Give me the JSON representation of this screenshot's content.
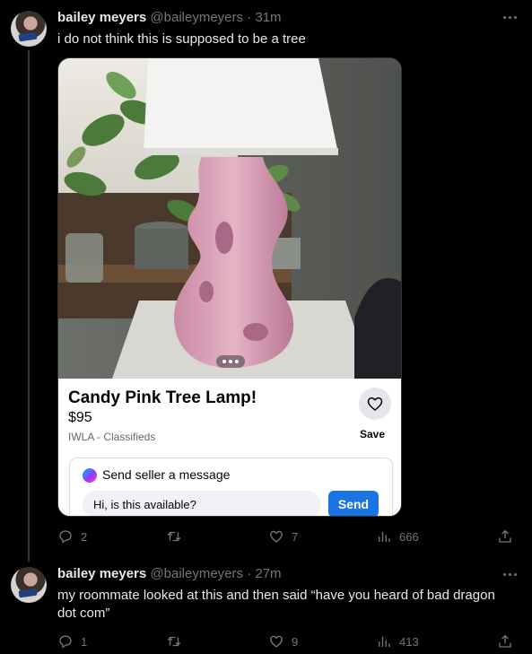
{
  "tweets": [
    {
      "name": "bailey meyers",
      "handle": "@baileymeyers",
      "separator": "·",
      "time": "31m",
      "text": "i do not think this is supposed to be a tree",
      "listing": {
        "title": "Candy Pink Tree Lamp!",
        "price": "$95",
        "location": "IWLA - Classifieds",
        "save_label": "Save",
        "message_title": "Send seller a message",
        "message_input": "Hi, is this available?",
        "send_label": "Send"
      },
      "replies": "2",
      "retweets": "",
      "likes": "7",
      "views": "666"
    },
    {
      "name": "bailey meyers",
      "handle": "@baileymeyers",
      "separator": "·",
      "time": "27m",
      "text": "my roommate looked at this and then said “have you heard of bad dragon dot com”",
      "replies": "1",
      "retweets": "",
      "likes": "9",
      "views": "413"
    }
  ],
  "icons": {
    "reply": "reply-icon",
    "retweet": "retweet-icon",
    "like": "heart-icon",
    "views": "views-icon",
    "share": "share-icon",
    "more": "more-icon"
  },
  "colors": {
    "background": "#000000",
    "secondary_text": "#71767b",
    "send_button": "#1b74e4"
  }
}
